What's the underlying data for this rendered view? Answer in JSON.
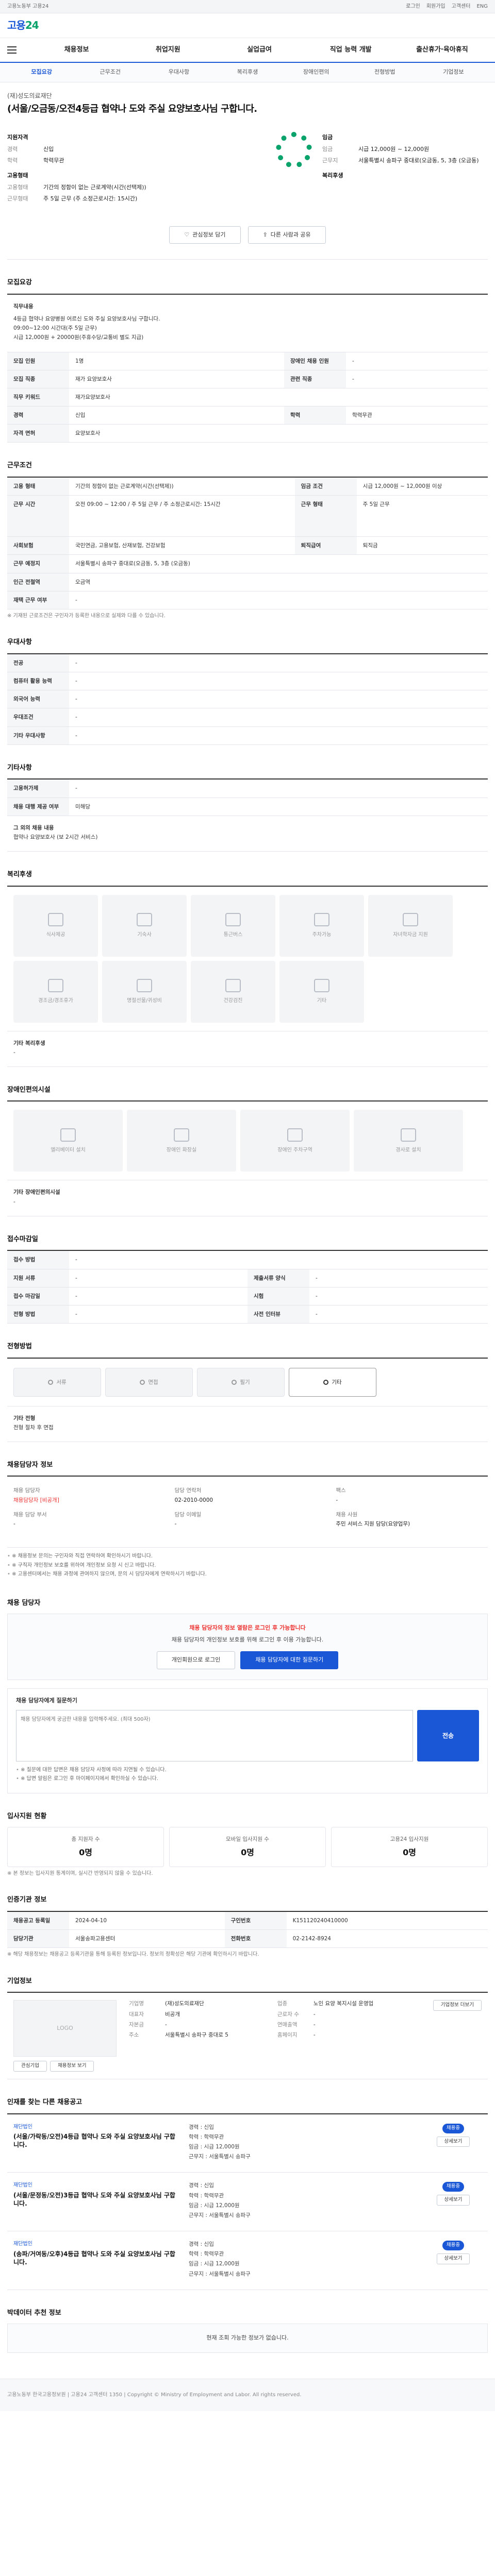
{
  "util": {
    "left": "고용노동부 고용24",
    "right": [
      "로그인",
      "회원가입",
      "고객센터",
      "ENG"
    ]
  },
  "brand": {
    "logo_main": "고용",
    "logo_accent": "24"
  },
  "gnb": [
    "채용정보",
    "취업지원",
    "실업급여",
    "직업 능력 개발",
    "출산휴가·육아휴직"
  ],
  "subtabs": [
    "모집요강",
    "근무조건",
    "우대사항",
    "복리후생",
    "장애인편의",
    "전형방법",
    "기업정보"
  ],
  "hero": {
    "company": "(재)성도의료재단",
    "title": "(서울/오금동/오전4등급 협약나 도와 주실 요양보호사님 구합니다.",
    "left_title": "지원자격",
    "left": [
      {
        "k": "경력",
        "v": "신입"
      },
      {
        "k": "학력",
        "v": "학력무관"
      }
    ],
    "left_title2": "고용형태",
    "left2": [
      {
        "k": "고용형태",
        "v": "기간의 정함이 없는 근로계약(시간(선택제))"
      },
      {
        "k": "근무형태",
        "v": "주 5일 근무 (주 소정근로시간: 15시간)"
      }
    ],
    "right_title": "임금",
    "right": [
      {
        "k": "임금",
        "v": "시급 12,000원 ~ 12,000원"
      },
      {
        "k": "근무지",
        "v": "서울특별시 송파구 중대로(오금동, 5, 3층 (오금동)"
      }
    ],
    "right_title2": "복리후생",
    "btn_scrap": "관심정보 담기",
    "btn_share": "다른 사람과 공유"
  },
  "recruit": {
    "title": "모집요강",
    "duty_title": "직무내용",
    "duty": [
      "4등급 협약나 요양병원 어르신 도와 주실 요양보호사님 구합니다.",
      "09:00~12:00 시간대(주 5일 근무)",
      "시급 12,000원 + 20000원(주휴수당/교통비 별도 지급)"
    ],
    "rows": [
      {
        "k1": "모집 인원",
        "v1": "1명",
        "k2": "장애인 채용 인원",
        "v2": "-"
      },
      {
        "k1": "모집 직종",
        "v1": "재가 요양보호사",
        "k2": "관련 직종",
        "v2": "-"
      },
      {
        "k1": "직무 키워드",
        "v1": "재가요양보호사",
        "k2": "",
        "v2": ""
      },
      {
        "k1": "경력",
        "v1": "신입",
        "k2": "학력",
        "v2": "학력무관"
      },
      {
        "k1": "자격 면허",
        "v1": "요양보호사",
        "k2": "",
        "v2": ""
      }
    ]
  },
  "conditions": {
    "title": "근무조건",
    "rows": [
      {
        "k": "고용 형태",
        "v": "기간의 정함이 없는 근로계약(시간(선택제))",
        "k2": "임금 조건",
        "v2": "시급 12,000원 ~ 12,000원 이상"
      },
      {
        "k": "근무 시간",
        "v": "오전 09:00 ~ 12:00 / 주 5일 근무 / 주 소정근로시간: 15시간",
        "k2": "근무 형태",
        "v2": "주 5일 근무"
      },
      {
        "k": "사회보험",
        "v": "국민연금, 고용보험, 산재보험, 건강보험",
        "k2": "퇴직급여",
        "v2": "퇴직금"
      },
      {
        "k": "근무 예정지",
        "v": "서울특별시 송파구 중대로(오금동, 5, 3층 (오금동)",
        "k2": "",
        "v2": ""
      },
      {
        "k": "인근 전철역",
        "v": "오금역",
        "k2": "",
        "v2": ""
      },
      {
        "k": "재택 근무 여부",
        "v": "-",
        "k2": "",
        "v2": ""
      }
    ],
    "note": "※ 기재된 근로조건은 구인자가 등록한 내용으로 실제와 다를 수 있습니다."
  },
  "prefer": {
    "title": "우대사항",
    "rows": [
      {
        "k": "전공",
        "v": "-"
      },
      {
        "k": "컴퓨터 활용 능력",
        "v": "-"
      },
      {
        "k": "외국어 능력",
        "v": "-"
      },
      {
        "k": "우대조건",
        "v": "-"
      },
      {
        "k": "기타 우대사항",
        "v": "-"
      }
    ]
  },
  "extra": {
    "title": "기타사항",
    "rows": [
      {
        "k": "고용허가제",
        "v": "-"
      },
      {
        "k": "채용 대행 제공 여부",
        "v": "미해당"
      }
    ],
    "sub_title": "그 외의 채용 내용",
    "sub_text": "협약나 요양보호사 (보 2시간 서비스)"
  },
  "welfare": {
    "title": "복리후생",
    "items": [
      "식사제공",
      "기숙사",
      "통근버스",
      "주차가능",
      "자녀학자금 지원",
      "경조금/경조휴가",
      "명절선물/귀성비",
      "건강검진",
      "기타"
    ],
    "other_title": "기타 복리후생",
    "other": "-"
  },
  "access": {
    "title": "장애인편의시설",
    "items": [
      "엘리베이터 설치",
      "장애인 화장실",
      "장애인 주차구역",
      "경사로 설치"
    ],
    "other_title": "기타 장애인편의시설",
    "other": "-"
  },
  "period": {
    "title": "접수마감일",
    "rows": [
      {
        "k": "접수 방법",
        "v": "-"
      },
      {
        "k": "지원 서류",
        "v": "-",
        "k2": "제출서류 양식",
        "v2": "-"
      },
      {
        "k": "접수 마감일",
        "v": "-",
        "k2": "시험",
        "v2": "-"
      },
      {
        "k": "전형 방법",
        "v": "-",
        "k2": "사전 인터뷰",
        "v2": "-"
      }
    ]
  },
  "process": {
    "title": "전형방법",
    "chips": [
      "서류",
      "면접",
      "필기",
      "기타"
    ],
    "active": 3,
    "note_title": "기타 전형",
    "note_text": "전형 절차 후 면접"
  },
  "contact": {
    "title": "채용담당자 정보",
    "cols": [
      {
        "l1": "채용 담당자",
        "v1": "채용담당자 [비공개]",
        "l2": "채용 담당 부서",
        "v2": "-"
      },
      {
        "l1": "담당 연락처",
        "v1": "02-2010-0000",
        "l2": "담당 이메일",
        "v2": "-"
      },
      {
        "l1": "팩스",
        "v1": "-",
        "l2": "채용 사원",
        "v2": "주민 서비스 지원 담당(요양업무)"
      }
    ],
    "bullets": [
      "※ 채용정보 문의는 구인자와 직접 연락하여 확인하시기 바랍니다.",
      "※ 구직자 개인정보 보호를 위하여 개인정보 요청 시 신고 바랍니다.",
      "※ 고용센터에서는 채용 과정에 관여하지 않으며, 문의 시 담당자에게 연락하시기 바랍니다."
    ]
  },
  "inquiry": {
    "title": "채용 담당자",
    "alert_red": "채용 담당자의 정보 열람은 로그인 후 가능합니다",
    "alert_text": "채용 담당자의 개인정보 보호를 위해 로그인 후 이용 가능합니다.",
    "btn_login": "개인회원으로 로그인",
    "btn_join": "채용 담당자에 대한 질문하기",
    "q_title": "채용 담당자에게 질문하기",
    "q_placeholder": "채용 담당자에게 궁금한 내용을 입력해주세요. (최대 500자)",
    "q_send": "전송",
    "notes": [
      "※ 질문에 대한 답변은 채용 담당자 사정에 따라 지연될 수 있습니다.",
      "※ 답변 알림은 로그인 후 마이페이지에서 확인하실 수 있습니다."
    ]
  },
  "stats": {
    "title": "입사지원 현황",
    "cards": [
      {
        "l": "총 지원자 수",
        "n": "0명"
      },
      {
        "l": "모바일 입사지원 수",
        "n": "0명"
      },
      {
        "l": "고용24 입사지원",
        "n": "0명"
      }
    ],
    "note": "※ 본 정보는 입사지원 통계이며, 실시간 반영되지 않을 수 있습니다."
  },
  "reg": {
    "title": "인증기관 정보",
    "rows": [
      {
        "k": "채용공고 등록일",
        "v": "2024-04-10",
        "k2": "구인번호",
        "v2": "K151120240410000"
      },
      {
        "k": "담당기관",
        "v": "서울송파고용센터",
        "k2": "전화번호",
        "v2": "02-2142-8924"
      }
    ],
    "note": "※ 해당 채용정보는 채용공고 등록기관을 통해 등록된 정보입니다. 정보의 정확성은 해당 기관에 확인하시기 바랍니다."
  },
  "company": {
    "title": "기업정보",
    "logo_text": "LOGO",
    "info": [
      {
        "k": "기업명",
        "v": "(재)성도의료재단"
      },
      {
        "k": "업종",
        "v": "노인 요양 복지시설 운영업"
      },
      {
        "k": "대표자",
        "v": "비공개"
      },
      {
        "k": "근로자 수",
        "v": "-"
      },
      {
        "k": "자본금",
        "v": "-"
      },
      {
        "k": "연매출액",
        "v": "-"
      },
      {
        "k": "주소",
        "v": "서울특별시 송파구 중대로 5"
      },
      {
        "k": "홈페이지",
        "v": "-"
      }
    ],
    "btn_more": "기업정보 더보기",
    "btn_a": "관심기업",
    "btn_b": "채용정보 보기"
  },
  "others": {
    "title": "인재를 찾는 다른 채용공고",
    "items": [
      {
        "co": "재단법인",
        "title": "(서울/가락동/오전)4등급 협약나 도와 주실 요양보호사님 구합니다.",
        "a": "경력 : 신입",
        "b": "학력 : 학력무관",
        "c": "임금 : 시급 12,000원",
        "d": "근무지 : 서울특별시 송파구",
        "badge": "채용중"
      },
      {
        "co": "재단법인",
        "title": "(서울/문정동/오전)3등급 협약나 도와 주실 요양보호사님 구합니다.",
        "a": "경력 : 신입",
        "b": "학력 : 학력무관",
        "c": "임금 : 시급 12,000원",
        "d": "근무지 : 서울특별시 송파구",
        "badge": "채용중"
      },
      {
        "co": "재단법인",
        "title": "(송파/거여동/오후)4등급 협약나 도와 주실 요양보호사님 구합니다.",
        "a": "경력 : 신입",
        "b": "학력 : 학력무관",
        "c": "임금 : 시급 12,000원",
        "d": "근무지 : 서울특별시 송파구",
        "badge": "채용중"
      }
    ],
    "detail_btn": "상세보기"
  },
  "recent": {
    "title": "박데이터 추천 정보",
    "text": "현재 조회 가능한 정보가 없습니다."
  },
  "footer": {
    "text": "고용노동부 한국고용정보원 | 고용24 고객센터 1350 | Copyright © Ministry of Employment and Labor. All rights reserved."
  }
}
